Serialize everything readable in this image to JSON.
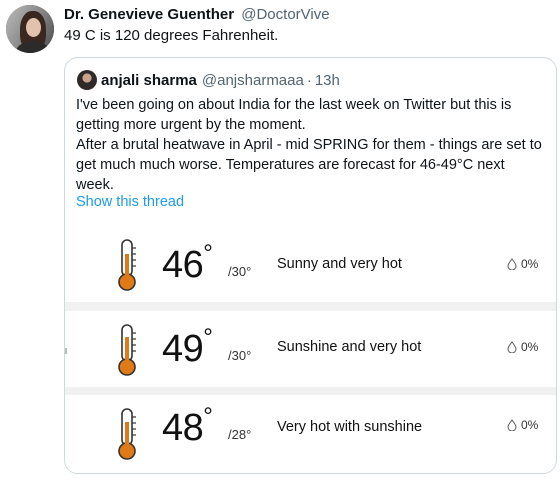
{
  "tweet": {
    "author_name": "Dr. Genevieve Guenther",
    "author_handle": "@DoctorVive",
    "text": "49 C is 120 degrees Fahrenheit."
  },
  "quoted_tweet": {
    "author_name": "anjali sharma",
    "author_handle": "@anjsharmaaa",
    "separator": "·",
    "time": "13h",
    "paragraph1": "I've been going on about India for the last week on Twitter but this is getting more urgent by the moment.",
    "paragraph2": "After a brutal heatwave in April - mid SPRING for them - things are set to get much much worse. Temperatures are forecast for 46-49°C next week.",
    "show_thread_label": "Show this thread"
  },
  "forecast": {
    "rows": [
      {
        "high": "46",
        "degree": "°",
        "low": "/30°",
        "description": "Sunny and very hot",
        "precip": "0%"
      },
      {
        "high": "49",
        "degree": "°",
        "low": "/30°",
        "description": "Sunshine and very hot",
        "precip": "0%"
      },
      {
        "high": "48",
        "degree": "°",
        "low": "/28°",
        "description": "Very hot with sunshine",
        "precip": "0%"
      }
    ]
  },
  "colors": {
    "link": "#1d9bf0",
    "secondary_text": "#536471",
    "thermometer_fill": "#e07a16",
    "border": "#cfd9de"
  },
  "icons": [
    "thermometer-icon",
    "raindrop-icon"
  ]
}
